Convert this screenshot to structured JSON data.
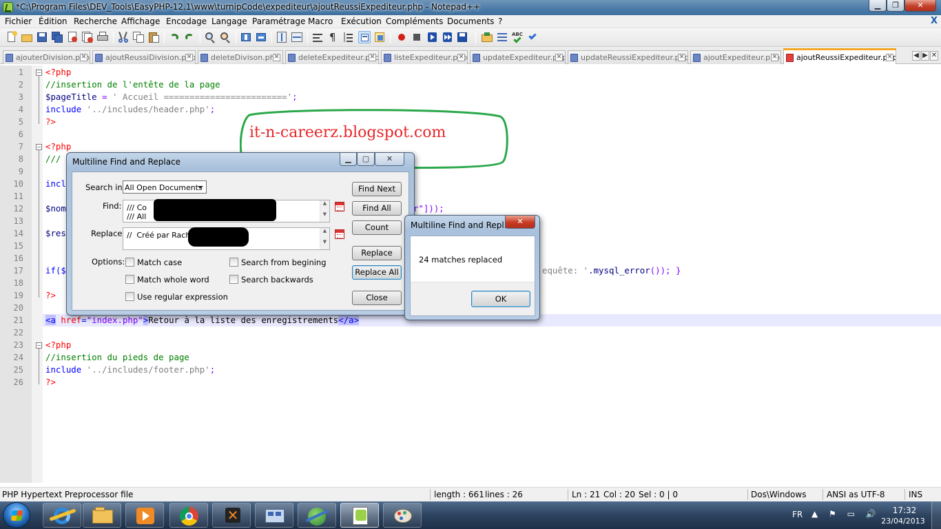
{
  "window": {
    "title": "*C:\\Program Files\\DEV_Tools\\EasyPHP-12.1\\www\\turnipCode\\expediteur\\ajoutReussiExpediteur.php - Notepad++",
    "min_label": "▁",
    "max_label": "❐",
    "close_label": "✕"
  },
  "menu": {
    "items": [
      "Fichier",
      "Édition",
      "Recherche",
      "Affichage",
      "Encodage",
      "Langage",
      "Paramétrage",
      "Macro",
      "Exécution",
      "Compléments",
      "Documents",
      "?"
    ],
    "close_glyph": "X"
  },
  "tabs": [
    {
      "label": "ajouterDivision.php",
      "active": false
    },
    {
      "label": "ajoutReussiDivision.php",
      "active": false
    },
    {
      "label": "deleteDivison.php",
      "active": false
    },
    {
      "label": "deleteExpediteur.php",
      "active": false
    },
    {
      "label": "listeExpediteur.php",
      "active": false
    },
    {
      "label": "updateExpediteur.php",
      "active": false
    },
    {
      "label": "updateReussiExpediteur.php",
      "active": false
    },
    {
      "label": "ajoutExpediteur.php",
      "active": false
    },
    {
      "label": "ajoutReussiExpediteur.php",
      "active": true
    }
  ],
  "tab_close": "✕",
  "tab_arrows": [
    "◀",
    "▶",
    "✕"
  ],
  "editor": {
    "line_numbers": [
      "1",
      "2",
      "3",
      "4",
      "5",
      "6",
      "7",
      "8",
      "9",
      "10",
      "11",
      "12",
      "13",
      "14",
      "15",
      "16",
      "17",
      "18",
      "19",
      "20",
      "21",
      "22",
      "23",
      "24",
      "25",
      "26"
    ],
    "code": {
      "l1": "<?php",
      "l2": "//insertion de l'entête de la page",
      "l3_var": "$pageTitle",
      "l3_op": " = ",
      "l3_str": "' Accueil ========================'",
      "l3_end": ";",
      "l4_kw": "include",
      "l4_str": " '../includes/header.php'",
      "l4_end": ";",
      "l5": "?>",
      "l7": "<?php",
      "l8": "///",
      "l10": "inclu",
      "l12": "$nom",
      "l12_tail": "r\"]));",
      "l14": "$res",
      "l17": "if($",
      "l17_tail_a": "equête: '",
      "l17_tail_b": ".mysql_error",
      "l17_tail_c": "()); }",
      "l19": "?>",
      "l21_open": "<a",
      "l21_attr": " href",
      "l21_eq": "=",
      "l21_val": "\"index.php\"",
      "l21_close": ">",
      "l21_text": "Retour à la liste des enregistrements",
      "l21_end": "</a>",
      "l23": "<?php",
      "l24": "//insertion du pieds de page",
      "l25_kw": "include",
      "l25_str": " '../includes/footer.php'",
      "l25_end": ";",
      "l26": "?>"
    }
  },
  "watermark": {
    "text": "it-n-careerz.blogspot.com",
    "color": "#e8262a",
    "bubble_color": "#2aa84a"
  },
  "find_dialog": {
    "title": "Multiline Find and Replace",
    "search_in_label": "Search in:",
    "search_in_value": "All Open Documents",
    "find_label": "Find:",
    "find_value": "/// Co\n/// All",
    "replace_label": "Replace:",
    "replace_value": "//  Créé par Rach",
    "options_label": "Options:",
    "options": {
      "match_case": "Match case",
      "match_whole_word": "Match whole word",
      "use_regex": "Use regular expression",
      "search_from_beginning": "Search from begining",
      "search_backwards": "Search backwards"
    },
    "buttons": {
      "find_next": "Find Next",
      "find_all": "Find All",
      "count": "Count",
      "replace": "Replace",
      "replace_all": "Replace All",
      "close": "Close"
    }
  },
  "message_box": {
    "title": "Multiline Find and Repl...",
    "message": "24 matches replaced",
    "ok": "OK"
  },
  "statusbar": {
    "file_type": "PHP Hypertext Preprocessor file",
    "length": "length : 661",
    "lines": "lines : 26",
    "ln": "Ln : 21",
    "col": "Col : 20",
    "sel": "Sel : 0 | 0",
    "eol": "Dos\\Windows",
    "encoding": "ANSI as UTF-8",
    "mode": "INS"
  },
  "taskbar": {
    "lang": "FR",
    "tray_glyphs": "▲ ⚑ ▭ 🔊",
    "time": "17:32",
    "date": "23/04/2013"
  }
}
